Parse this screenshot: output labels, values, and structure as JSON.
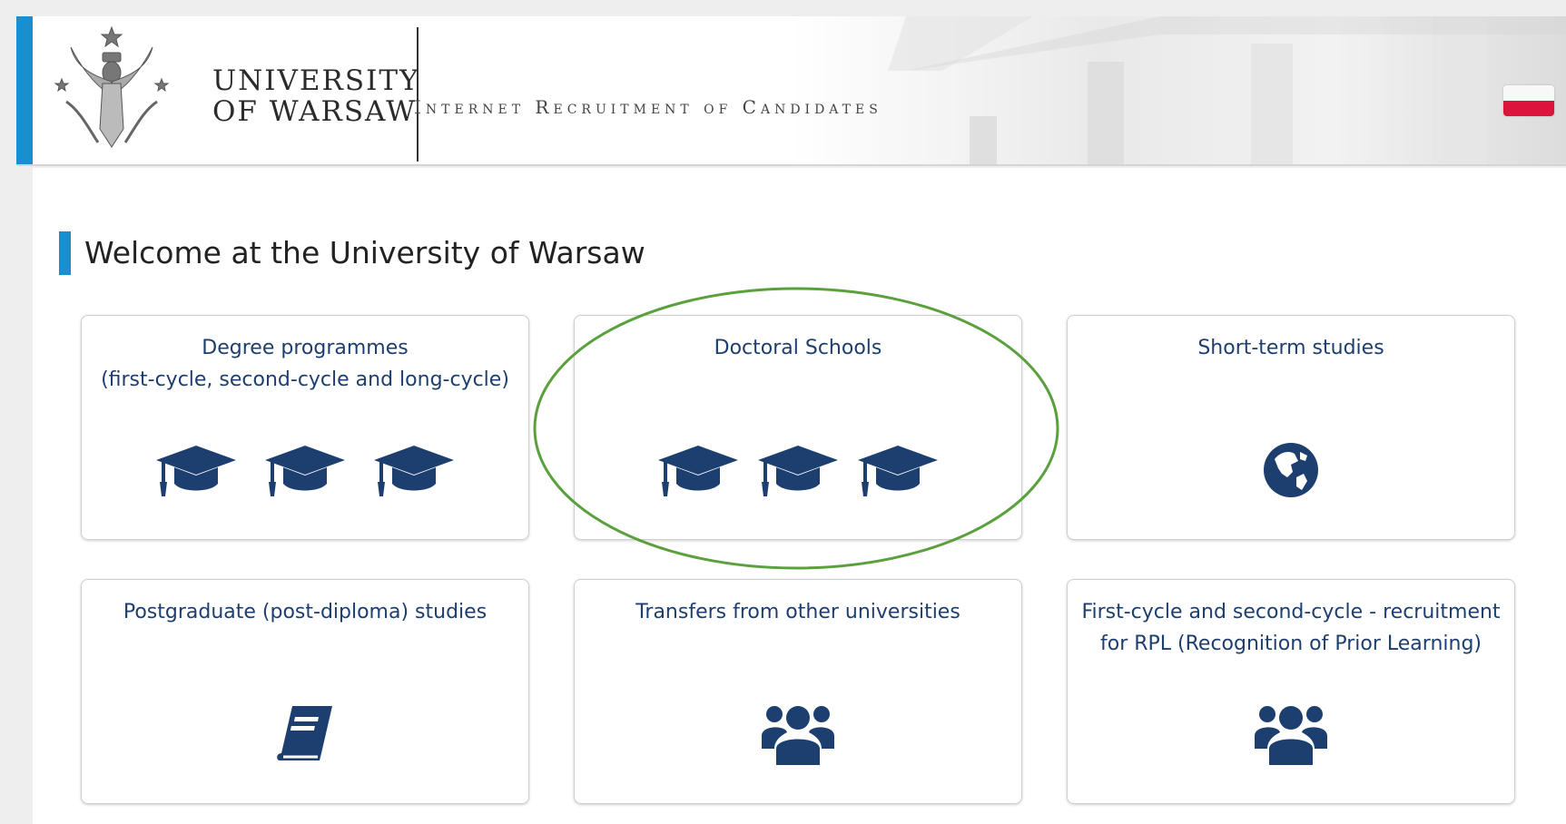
{
  "header": {
    "logo_line1": "UNIVERSITY",
    "logo_line2": "OF WARSAW",
    "title": "Internet Recruitment of Candidates",
    "language_flag": "polish-flag-icon"
  },
  "main": {
    "welcome": "Welcome at the University of Warsaw",
    "cards": [
      {
        "label": "Degree programmes\n(first-cycle, second-cycle and long-cycle)",
        "icon": "graduation-cap-icon",
        "icon_count": 3
      },
      {
        "label": "Doctoral Schools",
        "icon": "graduation-cap-icon",
        "icon_count": 3
      },
      {
        "label": "Short-term studies",
        "icon": "globe-icon",
        "icon_count": 1
      },
      {
        "label": "Postgraduate (post-diploma) studies",
        "icon": "book-icon",
        "icon_count": 1
      },
      {
        "label": "Transfers from other universities",
        "icon": "users-icon",
        "icon_count": 1
      },
      {
        "label": "First-cycle and second-cycle - recruitment\nfor RPL (Recognition of Prior Learning)",
        "icon": "users-icon",
        "icon_count": 1
      }
    ]
  },
  "colors": {
    "accent": "#1a8fd0",
    "icon": "#1d3f70",
    "highlight_ellipse": "#5aa03c",
    "flag_red": "#dc143c"
  }
}
